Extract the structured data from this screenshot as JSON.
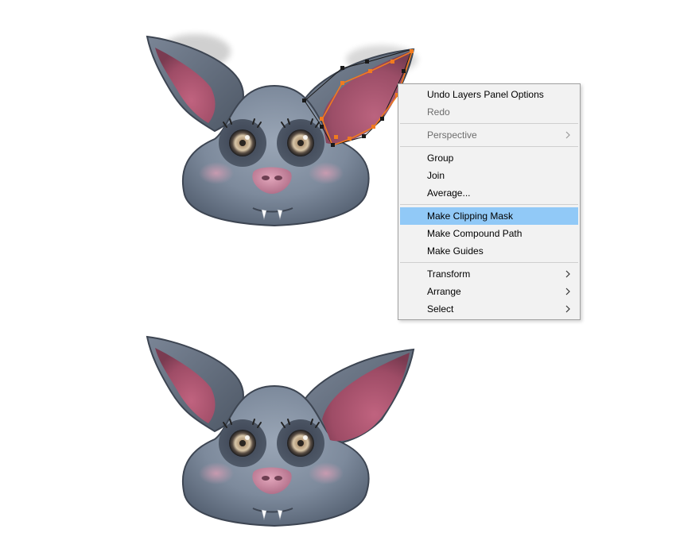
{
  "context_menu": {
    "items": [
      {
        "label": "Undo Layers Panel Options",
        "state": "enabled"
      },
      {
        "label": "Redo",
        "state": "disabled"
      },
      {
        "label": "Perspective",
        "state": "disabled",
        "submenu": true
      },
      {
        "label": "Group",
        "state": "enabled"
      },
      {
        "label": "Join",
        "state": "enabled"
      },
      {
        "label": "Average...",
        "state": "enabled"
      },
      {
        "label": "Make Clipping Mask",
        "state": "highlighted"
      },
      {
        "label": "Make Compound Path",
        "state": "enabled"
      },
      {
        "label": "Make Guides",
        "state": "enabled"
      },
      {
        "label": "Transform",
        "state": "enabled",
        "submenu": true
      },
      {
        "label": "Arrange",
        "state": "enabled",
        "submenu": true
      },
      {
        "label": "Select",
        "state": "enabled",
        "submenu": true
      }
    ]
  },
  "colors": {
    "menu_background": "#f2f2f2",
    "menu_highlight": "#91c9f7",
    "selection_path": "#f07b1f",
    "bat_body": "#6e7b8f",
    "ear_inner": "#b85874",
    "nose": "#c77d97"
  },
  "icons": {
    "submenu_indicator": "chevron-right-icon"
  }
}
